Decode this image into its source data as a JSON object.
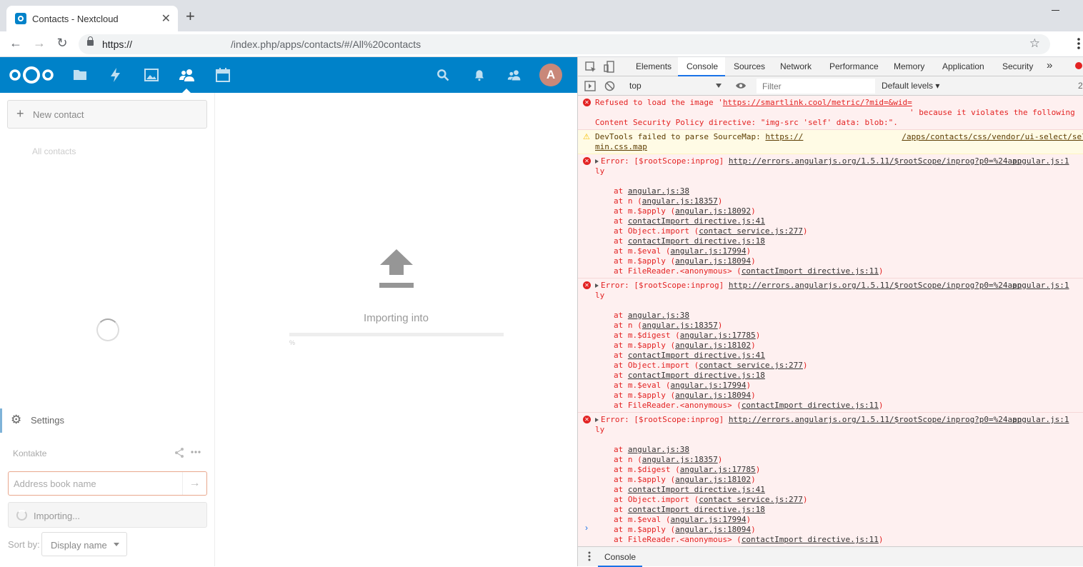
{
  "browser": {
    "tab_title": "Contacts - Nextcloud",
    "tab_close": "✕",
    "new_tab": "+",
    "url_prefix": "https://",
    "url_path": "/index.php/apps/contacts/#/All%20contacts"
  },
  "header": {
    "apps": [
      "files-icon",
      "activity-icon",
      "gallery-icon",
      "contacts-icon",
      "calendar-icon"
    ],
    "avatar_initial": "A",
    "brand_color": "#0082c9"
  },
  "sidebar": {
    "new_contact": "New contact",
    "all_contacts": "All contacts",
    "settings": "Settings",
    "addressbook_name": "Kontakte",
    "addressbook_placeholder": "Address book name",
    "importing": "Importing...",
    "sort_by_label": "Sort by:",
    "sort_by_value": "Display name"
  },
  "main": {
    "importing_into": "Importing into",
    "progress_percent": 0,
    "progress_label": "%"
  },
  "devtools": {
    "tabs": [
      "Elements",
      "Console",
      "Sources",
      "Network",
      "Performance",
      "Memory",
      "Application",
      "Security"
    ],
    "more": "»",
    "context": "top",
    "filter_placeholder": "Filter",
    "levels": "Default levels ▾",
    "msg_count": "2",
    "csp_error": {
      "line1_pre": "Refused to load the image '",
      "line1_link": "https://smartlink.cool/metric/?mid=&wid=",
      "line2": "' because it violates the following",
      "line3": "Content Security Policy directive: \"img-src 'self' data: blob:\"."
    },
    "warning": {
      "text": "DevTools failed to parse SourceMap: ",
      "link1": "https://",
      "link2": "/apps/contacts/css/vendor/ui-select/select.",
      "link3": "min.css.map"
    },
    "errors": [
      {
        "head": "Error: [$rootScope:inprog] ",
        "link": "http://errors.angularjs.org/1.5.11/$rootScope/inprog?p0=%24app",
        "src": "angular.js:1",
        "tail": "ly",
        "frames": [
          {
            "pre": "at ",
            "fn": "",
            "loc": "angular.js:38"
          },
          {
            "pre": "at n (",
            "fn": "",
            "loc": "angular.js:18357",
            "post": ")"
          },
          {
            "pre": "at m.$apply (",
            "fn": "",
            "loc": "angular.js:18092",
            "post": ")"
          },
          {
            "pre": "at ",
            "fn": "",
            "loc": "contactImport directive.js:41"
          },
          {
            "pre": "at Object.import (",
            "fn": "",
            "loc": "contact service.js:277",
            "post": ")"
          },
          {
            "pre": "at ",
            "fn": "",
            "loc": "contactImport directive.js:18"
          },
          {
            "pre": "at m.$eval (",
            "fn": "",
            "loc": "angular.js:17994",
            "post": ")"
          },
          {
            "pre": "at m.$apply (",
            "fn": "",
            "loc": "angular.js:18094",
            "post": ")"
          },
          {
            "pre": "at FileReader.<anonymous> (",
            "fn": "",
            "loc": "contactImport directive.js:11",
            "post": ")"
          }
        ]
      },
      {
        "head": "Error: [$rootScope:inprog] ",
        "link": "http://errors.angularjs.org/1.5.11/$rootScope/inprog?p0=%24app",
        "src": "angular.js:1",
        "tail": "ly",
        "frames": [
          {
            "pre": "at ",
            "fn": "",
            "loc": "angular.js:38"
          },
          {
            "pre": "at n (",
            "fn": "",
            "loc": "angular.js:18357",
            "post": ")"
          },
          {
            "pre": "at m.$digest (",
            "fn": "",
            "loc": "angular.js:17785",
            "post": ")"
          },
          {
            "pre": "at m.$apply (",
            "fn": "",
            "loc": "angular.js:18102",
            "post": ")"
          },
          {
            "pre": "at ",
            "fn": "",
            "loc": "contactImport directive.js:41"
          },
          {
            "pre": "at Object.import (",
            "fn": "",
            "loc": "contact service.js:277",
            "post": ")"
          },
          {
            "pre": "at ",
            "fn": "",
            "loc": "contactImport directive.js:18"
          },
          {
            "pre": "at m.$eval (",
            "fn": "",
            "loc": "angular.js:17994",
            "post": ")"
          },
          {
            "pre": "at m.$apply (",
            "fn": "",
            "loc": "angular.js:18094",
            "post": ")"
          },
          {
            "pre": "at FileReader.<anonymous> (",
            "fn": "",
            "loc": "contactImport directive.js:11",
            "post": ")"
          }
        ]
      },
      {
        "head": "Error: [$rootScope:inprog] ",
        "link": "http://errors.angularjs.org/1.5.11/$rootScope/inprog?p0=%24app",
        "src": "angular.js:1",
        "tail": "ly",
        "frames": [
          {
            "pre": "at ",
            "fn": "",
            "loc": "angular.js:38"
          },
          {
            "pre": "at n (",
            "fn": "",
            "loc": "angular.js:18357",
            "post": ")"
          },
          {
            "pre": "at m.$digest (",
            "fn": "",
            "loc": "angular.js:17785",
            "post": ")"
          },
          {
            "pre": "at m.$apply (",
            "fn": "",
            "loc": "angular.js:18102",
            "post": ")"
          },
          {
            "pre": "at ",
            "fn": "",
            "loc": "contactImport directive.js:41"
          },
          {
            "pre": "at Object.import (",
            "fn": "",
            "loc": "contact service.js:277",
            "post": ")"
          },
          {
            "pre": "at ",
            "fn": "",
            "loc": "contactImport directive.js:18"
          },
          {
            "pre": "at m.$eval (",
            "fn": "",
            "loc": "angular.js:17994",
            "post": ")"
          },
          {
            "pre": "at m.$apply (",
            "fn": "",
            "loc": "angular.js:18094",
            "post": ")"
          },
          {
            "pre": "at FileReader.<anonymous> (",
            "fn": "",
            "loc": "contactImport directive.js:11",
            "post": ")"
          }
        ]
      }
    ],
    "prompt": "›",
    "drawer_tab": "Console"
  }
}
